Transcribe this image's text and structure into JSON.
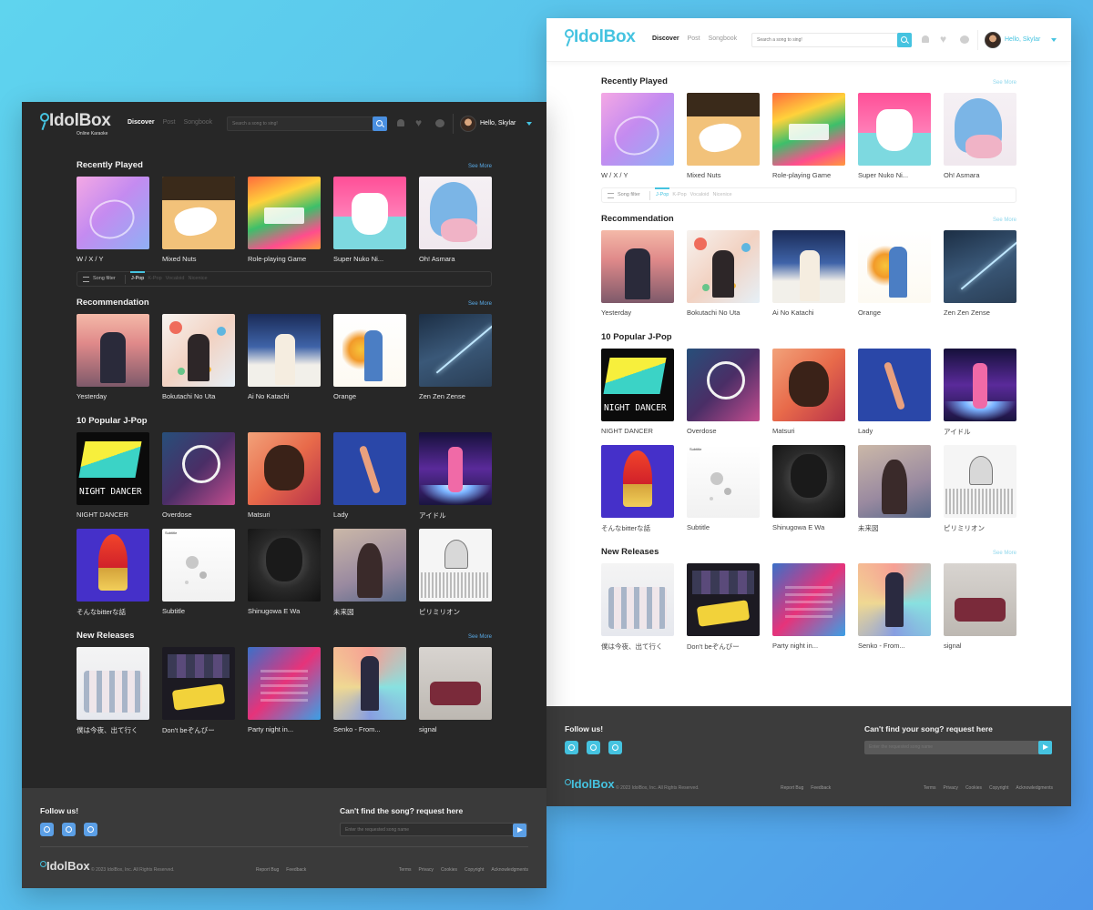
{
  "app": {
    "logo_word": "IdolBox",
    "logo_tag": "Online Karaoke",
    "nav": [
      "Discover",
      "Post",
      "Songbook"
    ],
    "search_placeholder": "Search a song to sing!",
    "greeting": "Hello, Skylar"
  },
  "sections": {
    "recent": {
      "title": "Recently Played",
      "see_more": "See More"
    },
    "filter": {
      "label": "Song filter",
      "tabs": [
        "J-Pop",
        "K-Pop",
        "Vocaloid",
        "Nicenice"
      ]
    },
    "recommend": {
      "title": "Recommendation",
      "see_more": "See More"
    },
    "popular": {
      "title": "10 Popular J-Pop"
    },
    "new": {
      "title": "New Releases",
      "see_more": "See More"
    }
  },
  "recent_items": [
    "W / X / Y",
    "Mixed Nuts",
    "Role-playing Game",
    "Super Nuko Ni...",
    "Oh! Asmara"
  ],
  "recommend_items": [
    "Yesterday",
    "Bokutachi No Uta",
    "Ai No Katachi",
    "Orange",
    "Zen Zen Zense"
  ],
  "popular_items": [
    "NIGHT DANCER",
    "Overdose",
    "Matsuri",
    "Lady",
    "アイドル",
    "そんなbitterな話",
    "Subtitle",
    "Shinugowa E Wa",
    "未来図",
    "ピリミリオン"
  ],
  "new_items": [
    "僕は今夜、出て行く",
    "Don't beぞんびー",
    "Party night in...",
    "Senko - From...",
    "signal"
  ],
  "footer": {
    "follow": "Follow us!",
    "request_light": "Can't find your song? request here",
    "request_dark": "Can't find the song? request here",
    "request_placeholder": "Enter the requested song name",
    "copyright": "© 2023 IdolBox, Inc. All Rights Reserved.",
    "links_mid": [
      "Report Bug",
      "Feedback"
    ],
    "links_right": [
      "Terms",
      "Privacy",
      "Cookies",
      "Copyright",
      "Acknowledgments"
    ]
  },
  "colors": {
    "accent_light": "#45c3e0",
    "accent_dark": "#5b9fe6",
    "dark_bg": "#272727",
    "footer_bg": "#3c3c3c"
  }
}
